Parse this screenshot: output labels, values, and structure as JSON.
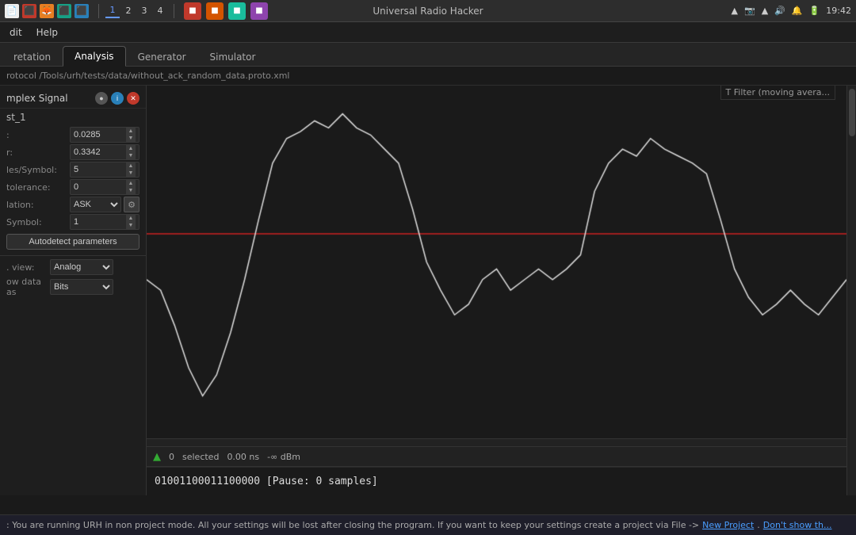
{
  "taskbar": {
    "app_title": "Universal Radio Hacker",
    "nums": [
      "1",
      "2",
      "3",
      "4"
    ],
    "active_num": "1",
    "time": "19:42",
    "window_title_label": "Universal Radio Hacker"
  },
  "menubar": {
    "items": [
      {
        "label": "dit",
        "id": "menu-edit"
      },
      {
        "label": "Help",
        "id": "menu-help"
      }
    ]
  },
  "tabs": [
    {
      "label": "retation",
      "id": "tab-interpretation",
      "active": false
    },
    {
      "label": "Analysis",
      "id": "tab-analysis",
      "active": true
    },
    {
      "label": "Generator",
      "id": "tab-generator",
      "active": false
    },
    {
      "label": "Simulator",
      "id": "tab-simulator",
      "active": false
    }
  ],
  "filepath": {
    "protocol_label": "rotocol",
    "path": "/Tools/urh/tests/data/without_ack_random_data.proto.xml"
  },
  "signal": {
    "name": "mplex Signal",
    "instance": "st_1",
    "params": {
      "dc_offset_label": ":",
      "dc_offset_value": "0.0285",
      "threshold_label": "r:",
      "threshold_value": "0.3342",
      "samples_per_symbol_label": "les/Symbol:",
      "samples_per_symbol_value": "5",
      "tolerance_label": "tolerance:",
      "tolerance_value": "0",
      "modulation_label": "lation:",
      "modulation_value": "ASK",
      "symbol_label": "Symbol:",
      "symbol_value": "1"
    },
    "autodetect_label": "Autodetect parameters",
    "view_label": ". view:",
    "view_value": "Analog",
    "show_data_label": "ow data as",
    "show_data_value": "Bits"
  },
  "signal_statusbar": {
    "selected_count": "0",
    "selected_label": "selected",
    "time_ns": "0.00 ns",
    "power_dbm": "-∞ dBm",
    "filter_label": "T Filter (moving avera..."
  },
  "bits_display": {
    "value": "01001100011100000 [Pause: 0 samples]"
  },
  "bottom_statusbar": {
    "message": ": You are running URH in non project mode. All your settings will be lost after closing the program. If you want to keep your settings create a project via File ->",
    "link_new_project": "New Project",
    "link_dont_show": "Don't show th..."
  }
}
